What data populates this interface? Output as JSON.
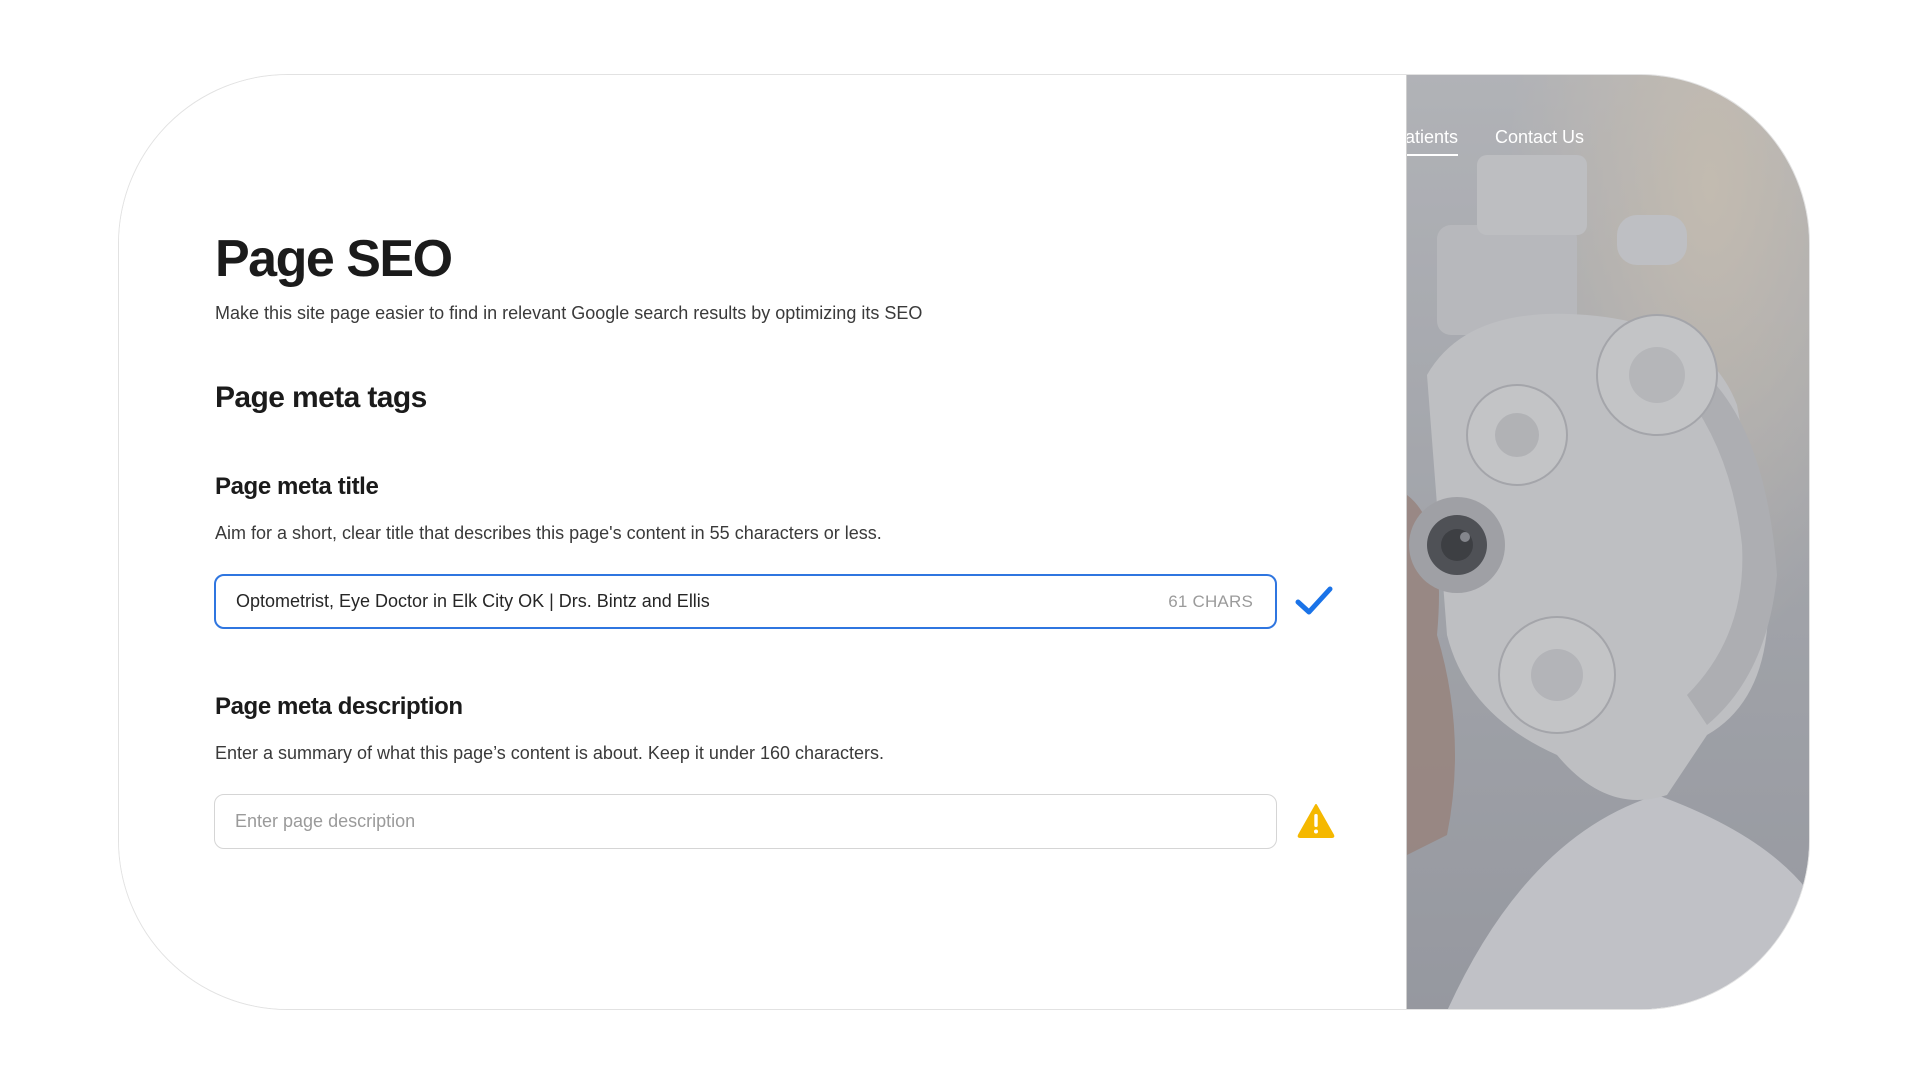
{
  "page": {
    "title": "Page SEO",
    "subtitle": "Make this site page easier to find in relevant Google search results by optimizing its SEO",
    "section_title": "Page meta tags"
  },
  "meta_title": {
    "label": "Page meta title",
    "help": "Aim for a short, clear title that describes this page's content in 55 characters or less.",
    "value": "Optometrist, Eye Doctor in Elk City OK | Drs. Bintz and Ellis",
    "char_count": "61 CHARS",
    "status_icon": "checkmark-icon",
    "status_color": "#1a73e8"
  },
  "meta_description": {
    "label": "Page meta description",
    "help": "Enter a summary of what this page’s content is about. Keep it under 160 characters.",
    "placeholder": "Enter page description",
    "status_icon": "warning-icon",
    "status_color": "#f5b800"
  },
  "site_preview": {
    "nav": [
      {
        "label": "atients"
      },
      {
        "label": "Contact Us"
      }
    ],
    "active_nav_index": 0
  },
  "colors": {
    "focus_border": "#2f76e0",
    "text_primary": "#1b1b1b",
    "text_secondary": "#3a3a3a"
  }
}
